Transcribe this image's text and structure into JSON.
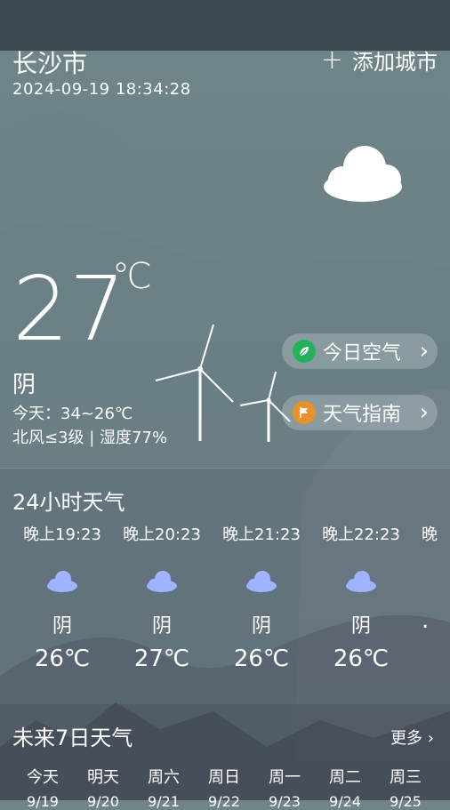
{
  "header": {
    "city": "长沙市",
    "datetime": "2024-09-19 18:34:28",
    "add_city_label": "添加城市",
    "add_icon": "plus-icon"
  },
  "current": {
    "temperature": "27",
    "unit": "℃",
    "condition": "阴",
    "today_range": "今天：34~26℃",
    "wind_humidity": "北风≤3级 | 湿度77%",
    "condition_icon": "cloud-icon"
  },
  "shortcuts": {
    "air_label": "今日空气",
    "air_icon": "leaf-icon",
    "guide_label": "天气指南",
    "guide_icon": "flag-icon"
  },
  "hourly": {
    "title": "24小时天气",
    "items": [
      {
        "time": "晚上19:23",
        "cond": "阴",
        "temp": "26℃"
      },
      {
        "time": "晚上20:23",
        "cond": "阴",
        "temp": "27℃"
      },
      {
        "time": "晚上21:23",
        "cond": "阴",
        "temp": "26℃"
      },
      {
        "time": "晚上22:23",
        "cond": "阴",
        "temp": "26℃"
      },
      {
        "time": "晚",
        "cond": "",
        "temp": "."
      }
    ]
  },
  "weekly": {
    "title": "未来7日天气",
    "more_label": "更多",
    "days": [
      {
        "name": "今天",
        "date": "9/19"
      },
      {
        "name": "明天",
        "date": "9/20"
      },
      {
        "name": "周六",
        "date": "9/21"
      },
      {
        "name": "周日",
        "date": "9/22"
      },
      {
        "name": "周一",
        "date": "9/23"
      },
      {
        "name": "周二",
        "date": "9/24"
      },
      {
        "name": "周三",
        "date": "9/25"
      }
    ]
  },
  "colors": {
    "air_badge": "#22b25a",
    "guide_badge": "#e9922a",
    "hourly_cloud": "#9fb4ff"
  }
}
